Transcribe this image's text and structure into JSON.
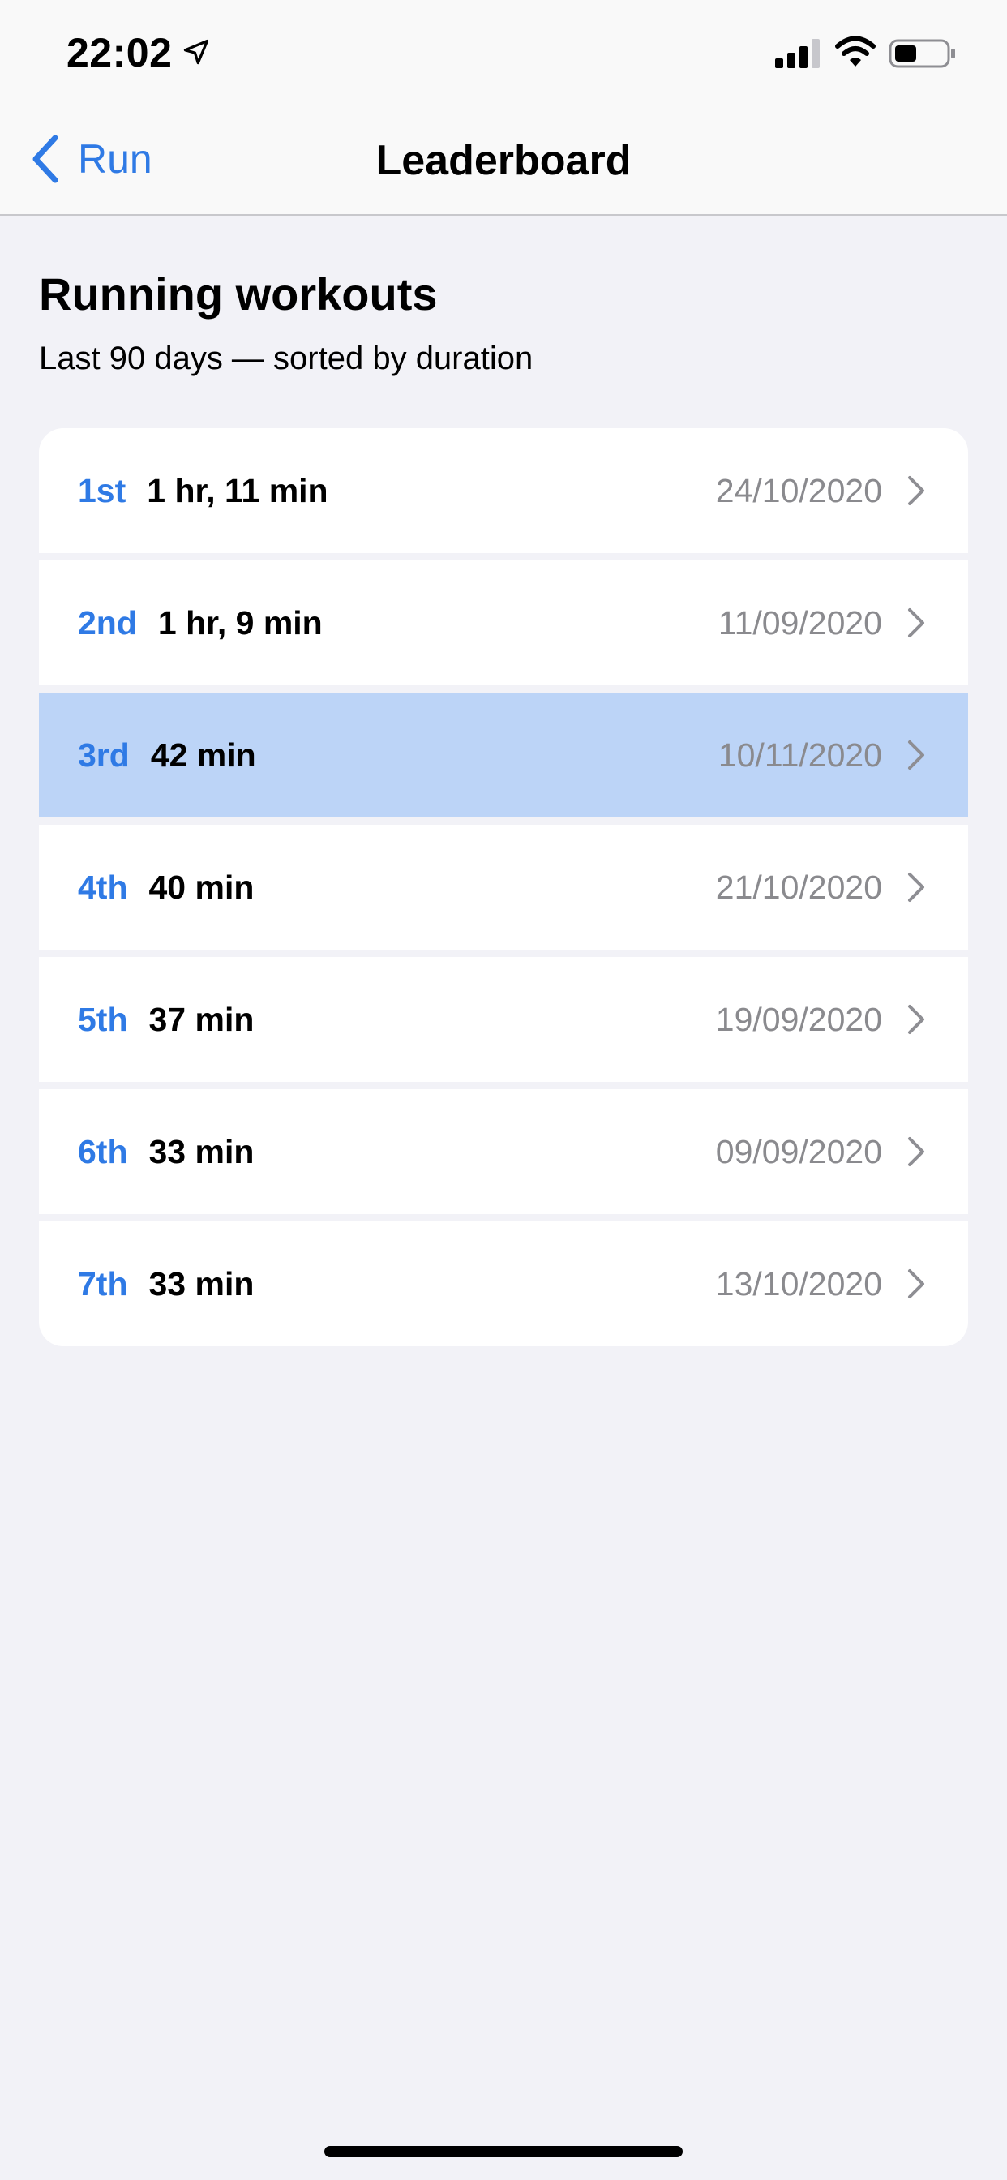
{
  "status_bar": {
    "time": "22:02",
    "icons": [
      "location-arrow-icon",
      "cellular-signal-icon",
      "wifi-icon",
      "battery-icon"
    ]
  },
  "nav": {
    "back_label": "Run",
    "title": "Leaderboard"
  },
  "section": {
    "title": "Running workouts",
    "subtitle": "Last 90 days — sorted by duration"
  },
  "colors": {
    "accent": "#2f7ae5",
    "selected_row": "#bcd4f7",
    "date_gray": "#8a8a8e",
    "background": "#f2f2f7"
  },
  "rows": [
    {
      "rank": "1st",
      "duration": "1 hr, 11 min",
      "date": "24/10/2020",
      "selected": false
    },
    {
      "rank": "2nd",
      "duration": "1 hr, 9 min",
      "date": "11/09/2020",
      "selected": false
    },
    {
      "rank": "3rd",
      "duration": "42 min",
      "date": "10/11/2020",
      "selected": true
    },
    {
      "rank": "4th",
      "duration": "40 min",
      "date": "21/10/2020",
      "selected": false
    },
    {
      "rank": "5th",
      "duration": "37 min",
      "date": "19/09/2020",
      "selected": false
    },
    {
      "rank": "6th",
      "duration": "33 min",
      "date": "09/09/2020",
      "selected": false
    },
    {
      "rank": "7th",
      "duration": "33 min",
      "date": "13/10/2020",
      "selected": false
    }
  ]
}
